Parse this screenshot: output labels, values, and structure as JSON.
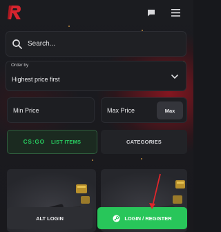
{
  "colors": {
    "accent_green": "#28c65a",
    "brand_red": "#d6242e",
    "background": "#17181c"
  },
  "header": {
    "logo_icon": "r-logo-icon",
    "chat_icon": "chat-icon",
    "menu_icon": "hamburger-menu-icon"
  },
  "search": {
    "placeholder": "Search...",
    "icon": "search-icon"
  },
  "order": {
    "label": "Order by",
    "selected": "Highest price first",
    "icon": "chevron-down-icon"
  },
  "price": {
    "min_placeholder": "Min Price",
    "max_placeholder": "Max Price",
    "max_button": "Max"
  },
  "tabs": [
    {
      "label": "LIST ITEMS",
      "game_logo": "CS:GO",
      "active": true
    },
    {
      "label": "CATEGORIES",
      "active": false
    }
  ],
  "items": [
    {
      "image": "awp-rifle-icon"
    },
    {
      "image": "awp-rifle-icon"
    }
  ],
  "buttons": {
    "alt_login": "ALT LOGIN",
    "login_register": "LOGIN / REGISTER",
    "login_icon": "steam-icon"
  }
}
